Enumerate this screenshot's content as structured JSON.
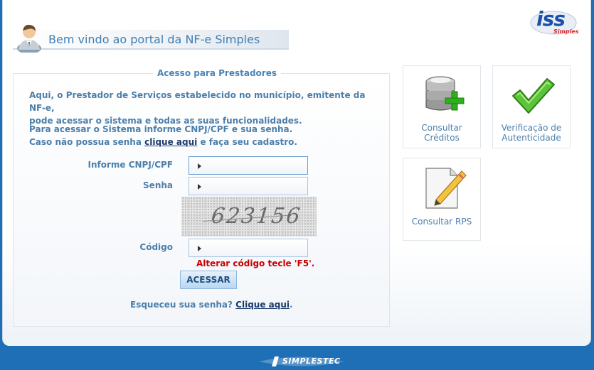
{
  "header": {
    "welcome": "Bem vindo ao portal da NF-e Simples",
    "logo_main": "iss",
    "logo_sub": "Simples"
  },
  "login": {
    "legend": "Acesso para Prestadores",
    "intro_line1": "Aqui, o Prestador de Serviços estabelecido no município, emitente da NF-e,",
    "intro_line2": "pode acessar o sistema e todas as suas funcionalidades.",
    "instr_line1": "Para acessar o Sistema informe CNPJ/CPF e sua senha.",
    "instr_line2_pre": "Caso não possua senha ",
    "instr_link": "clique aqui",
    "instr_line2_post": " e faça seu cadastro.",
    "cnpj_label": "Informe CNPJ/CPF",
    "senha_label": "Senha",
    "codigo_label": "Código",
    "captcha_text": "623156",
    "alter_codigo": "Alterar código tecle 'F5'.",
    "acessar_label": "ACESSAR",
    "forgot_pre": "Esqueceu sua senha? ",
    "forgot_link": "Clique aqui",
    "forgot_post": "."
  },
  "tiles": {
    "consultar_creditos": "Consultar\nCréditos",
    "verificacao": "Verificação de\nAutenticidade",
    "consultar_rps": "Consultar RPS"
  },
  "footer": {
    "brand": "SIMPLESTEC"
  },
  "colors": {
    "background": "#1e6fb5",
    "text_blue": "#4c7fab",
    "alert_red": "#cc0000"
  }
}
